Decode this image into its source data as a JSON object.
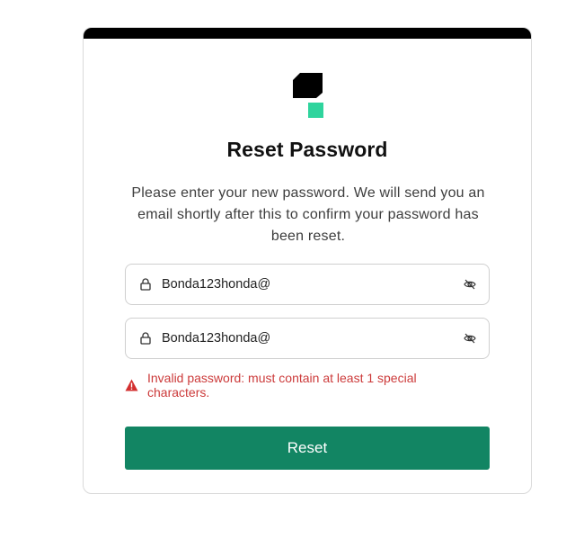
{
  "page": {
    "title": "Reset Password",
    "description": "Please enter your new password. We will send you an email shortly after this to confirm your password has been reset."
  },
  "form": {
    "password": {
      "value": "Bonda123honda@",
      "icon": "lock-icon",
      "toggle_icon": "eye-off-icon"
    },
    "confirm_password": {
      "value": "Bonda123honda@",
      "icon": "lock-icon",
      "toggle_icon": "eye-off-icon"
    },
    "error": {
      "icon": "warning-icon",
      "message": "Invalid password: must contain at least 1 special characters."
    },
    "submit_label": "Reset"
  },
  "colors": {
    "brand_dark": "#000000",
    "brand_accent": "#2fd49d",
    "button": "#128563",
    "error": "#cc3a3a"
  }
}
